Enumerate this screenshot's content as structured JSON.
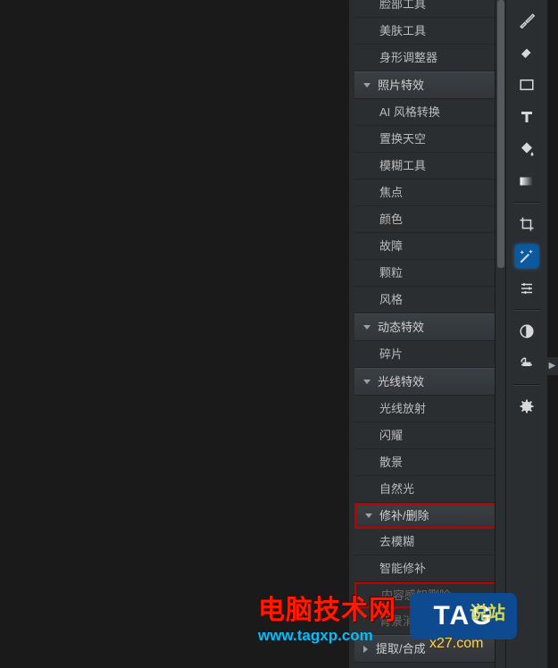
{
  "panel": {
    "items_top": [
      {
        "label": "脸部工具"
      },
      {
        "label": "美肤工具"
      },
      {
        "label": "身形调整器"
      }
    ],
    "cat_photo_effects": "照片特效",
    "photo_effects_items": [
      {
        "label": "AI 风格转换"
      },
      {
        "label": "置换天空"
      },
      {
        "label": "模糊工具"
      },
      {
        "label": "焦点"
      },
      {
        "label": "颜色"
      },
      {
        "label": "故障"
      },
      {
        "label": "颗粒"
      },
      {
        "label": "风格"
      }
    ],
    "cat_dynamic_effects": "动态特效",
    "dynamic_effects_items": [
      {
        "label": "碎片"
      }
    ],
    "cat_light_effects": "光线特效",
    "light_effects_items": [
      {
        "label": "光线放射"
      },
      {
        "label": "闪耀"
      },
      {
        "label": "散景"
      },
      {
        "label": "自然光"
      }
    ],
    "cat_repair_remove": "修补/删除",
    "repair_remove_items": [
      {
        "label": "去模糊"
      },
      {
        "label": "智能修补"
      },
      {
        "label": "内容感知删除",
        "highlighted": true,
        "dimmed": true
      },
      {
        "label": "背景消除",
        "dimmed": true
      }
    ],
    "cat_extract_compose": "提取/合成"
  },
  "toolbar": {
    "tools": [
      {
        "name": "brush-icon"
      },
      {
        "name": "eraser-icon"
      },
      {
        "name": "rectangle-icon"
      },
      {
        "name": "text-icon"
      },
      {
        "name": "fill-icon"
      },
      {
        "name": "gradient-icon"
      }
    ],
    "tools2": [
      {
        "name": "crop-icon"
      },
      {
        "name": "magic-wand-icon",
        "selected": true
      },
      {
        "name": "adjustments-icon"
      }
    ],
    "tools3": [
      {
        "name": "contrast-circle-icon"
      },
      {
        "name": "align-icon"
      }
    ],
    "tools4": [
      {
        "name": "gear-icon"
      }
    ]
  },
  "watermark": {
    "text1": "电脑技术网",
    "url1": "www.tagxp.com",
    "tag": "TAG",
    "text2": "说站",
    "url2": "x27.com"
  }
}
